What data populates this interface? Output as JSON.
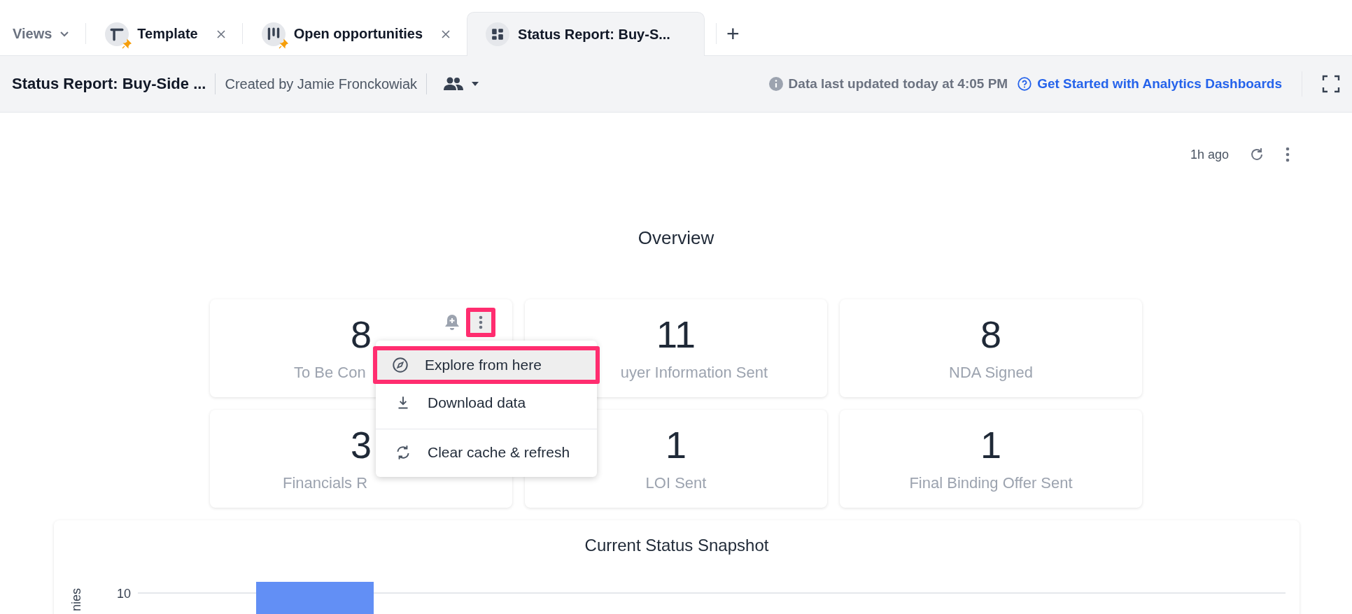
{
  "views_menu": {
    "label": "Views"
  },
  "tabs": [
    {
      "label": "Template",
      "pinned": true,
      "selected": false
    },
    {
      "label": "Open opportunities",
      "pinned": true,
      "selected": false
    },
    {
      "label": "Status Report: Buy-S...",
      "pinned": false,
      "selected": true
    }
  ],
  "add_tab": "+",
  "header": {
    "title": "Status Report: Buy-Side ...",
    "created_by": "Created by Jamie Fronckowiak",
    "updated": "Data last updated today at 4:05 PM",
    "help_link": "Get Started with Analytics Dashboards"
  },
  "toolbar": {
    "last_refresh": "1h ago"
  },
  "section_title": "Overview",
  "cards": [
    {
      "kind": "actions",
      "value": "8",
      "label": "To Be Con"
    },
    {
      "kind": "plain",
      "value": "11",
      "label": "uyer Information Sent"
    },
    {
      "kind": "plain",
      "value": "8",
      "label": "NDA Signed"
    },
    {
      "kind": "plain",
      "value": "3",
      "label": "Financials R"
    },
    {
      "kind": "plain",
      "value": "1",
      "label": "LOI Sent"
    },
    {
      "kind": "plain",
      "value": "1",
      "label": "Final Binding Offer Sent"
    }
  ],
  "card_menu_button": {
    "highlighted": true
  },
  "context_menu": {
    "items": [
      {
        "label": "Explore from here",
        "highlighted": true
      },
      {
        "label": "Download data",
        "highlighted": false
      },
      {
        "label": "Clear cache & refresh",
        "highlighted": false
      }
    ]
  },
  "chart_panel": {
    "title": "Current Status Snapshot",
    "ylabel": "nies",
    "ytick": "10"
  }
}
